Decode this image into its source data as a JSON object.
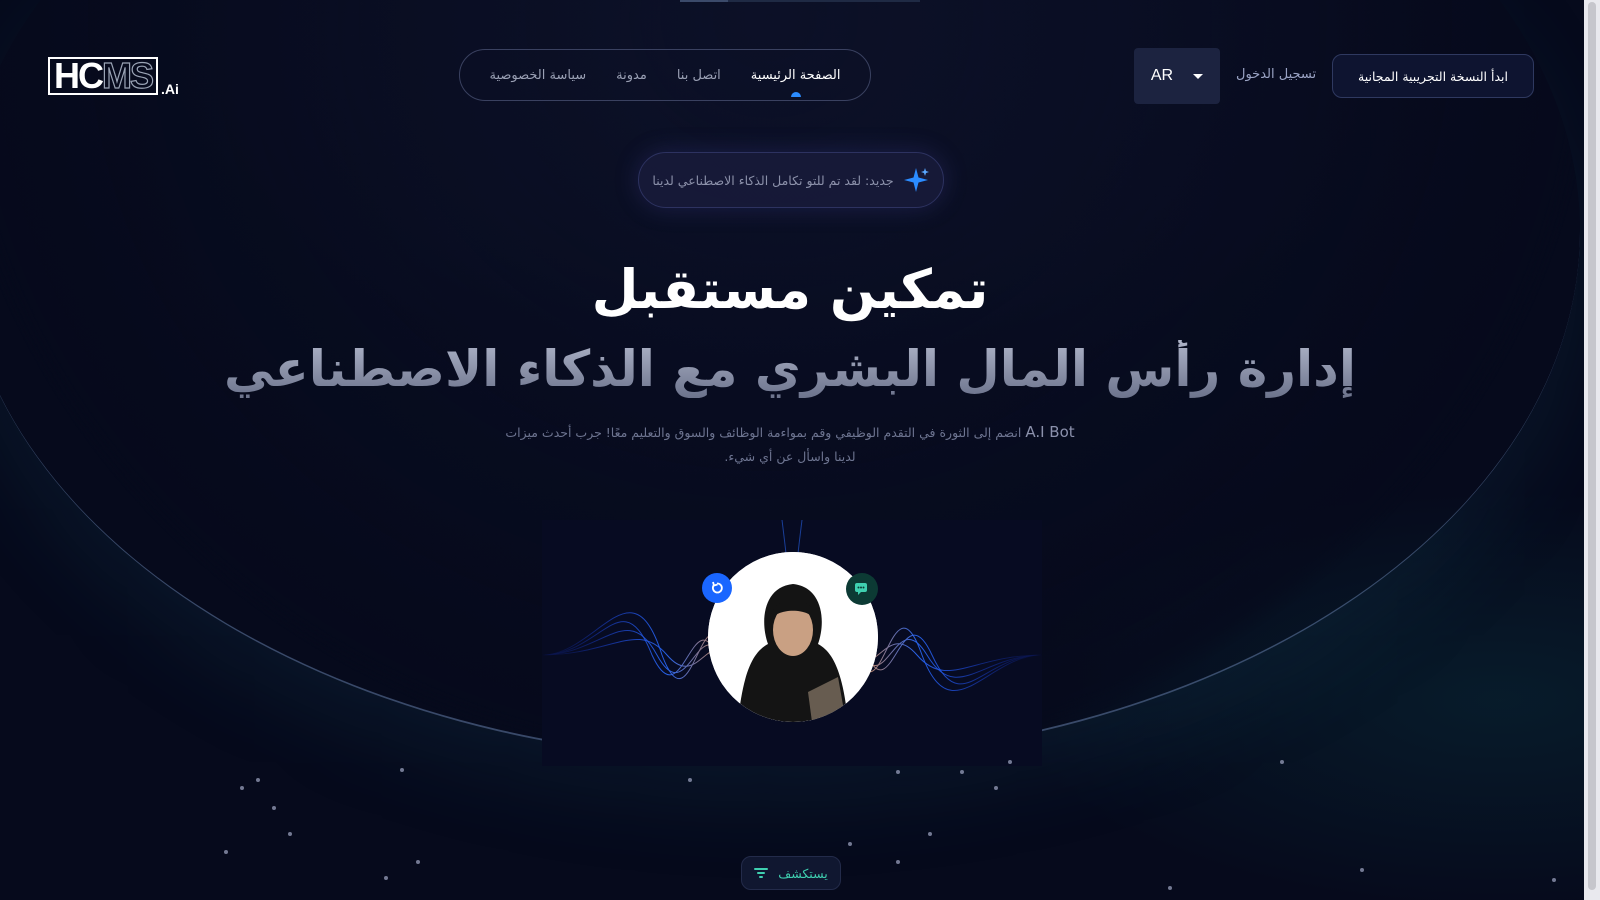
{
  "header": {
    "logo": {
      "text_main": "HC",
      "text_outline": "MS",
      "text_suffix": ".Ai"
    },
    "nav": [
      {
        "label": "الصفحة الرئيسية",
        "active": true
      },
      {
        "label": "اتصل بنا",
        "active": false
      },
      {
        "label": "مدونة",
        "active": false
      },
      {
        "label": "سياسة الخصوصية",
        "active": false
      }
    ],
    "language": {
      "value": "AR",
      "icon": "chevron-down-icon"
    },
    "login_label": "تسجيل الدخول",
    "trial_label": "ابدأ النسخة التجريبية المجانية"
  },
  "announcement": {
    "text": "جديد: لقد تم للتو تكامل الذكاء الاصطناعي لدينا",
    "icon": "sparkle-icon"
  },
  "hero": {
    "title_line1": "تمكين مستقبل",
    "title_line2": "إدارة رأس المال البشري مع الذكاء الاصطناعي",
    "subtitle_prefix": "A.I Bot",
    "subtitle_rest": "انضم إلى الثورة في التقدم الوظيفي وقم بمواءمة الوظائف والسوق والتعليم معًا! جرب أحدث ميزات",
    "subtitle_line2": "لدينا واسأل عن أي شيء."
  },
  "assistant": {
    "refresh_icon": "refresh-icon",
    "chat_icon": "chat-icon",
    "avatar": "assistant-avatar"
  },
  "explore": {
    "label": "يستكشف",
    "icon": "filter-icon"
  },
  "colors": {
    "background": "#060a1c",
    "accent_blue": "#2b8cff",
    "accent_teal": "#3fd0b0"
  }
}
